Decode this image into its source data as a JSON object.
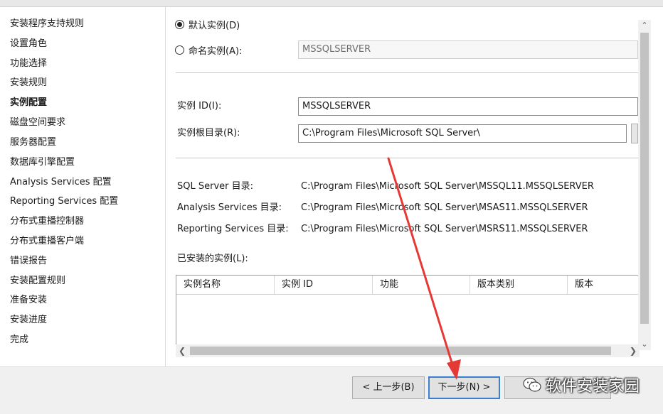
{
  "sidebar": {
    "items": [
      {
        "label": "安装程序支持规则",
        "active": false
      },
      {
        "label": "设置角色",
        "active": false
      },
      {
        "label": "功能选择",
        "active": false
      },
      {
        "label": "安装规则",
        "active": false
      },
      {
        "label": "实例配置",
        "active": true
      },
      {
        "label": "磁盘空间要求",
        "active": false
      },
      {
        "label": "服务器配置",
        "active": false
      },
      {
        "label": "数据库引擎配置",
        "active": false
      },
      {
        "label": "Analysis Services 配置",
        "active": false
      },
      {
        "label": "Reporting Services 配置",
        "active": false
      },
      {
        "label": "分布式重播控制器",
        "active": false
      },
      {
        "label": "分布式重播客户端",
        "active": false
      },
      {
        "label": "错误报告",
        "active": false
      },
      {
        "label": "安装配置规则",
        "active": false
      },
      {
        "label": "准备安装",
        "active": false
      },
      {
        "label": "安装进度",
        "active": false
      },
      {
        "label": "完成",
        "active": false
      }
    ]
  },
  "instance": {
    "default_label": "默认实例(D)",
    "named_label": "命名实例(A):",
    "default_selected": true,
    "named_value": "MSSQLSERVER",
    "id_label": "实例 ID(I):",
    "id_value": "MSSQLSERVER",
    "root_label": "实例根目录(R):",
    "root_value": "C:\\Program Files\\Microsoft SQL Server\\"
  },
  "dirs": {
    "sql_label": "SQL Server 目录:",
    "sql_value": "C:\\Program Files\\Microsoft SQL Server\\MSSQL11.MSSQLSERVER",
    "as_label": "Analysis Services 目录:",
    "as_value": "C:\\Program Files\\Microsoft SQL Server\\MSAS11.MSSQLSERVER",
    "rs_label": "Reporting Services 目录:",
    "rs_value": "C:\\Program Files\\Microsoft SQL Server\\MSRS11.MSSQLSERVER"
  },
  "installed": {
    "label": "已安装的实例(L):",
    "columns": [
      "实例名称",
      "实例 ID",
      "功能",
      "版本类别",
      "版本"
    ]
  },
  "footer": {
    "back_label": "< 上一步(B)",
    "next_label": "下一步(N) >"
  },
  "watermark": {
    "text": "软件安装家园"
  },
  "colors": {
    "annotation_arrow": "#e53935",
    "primary_button_border": "#3c7fd0"
  }
}
